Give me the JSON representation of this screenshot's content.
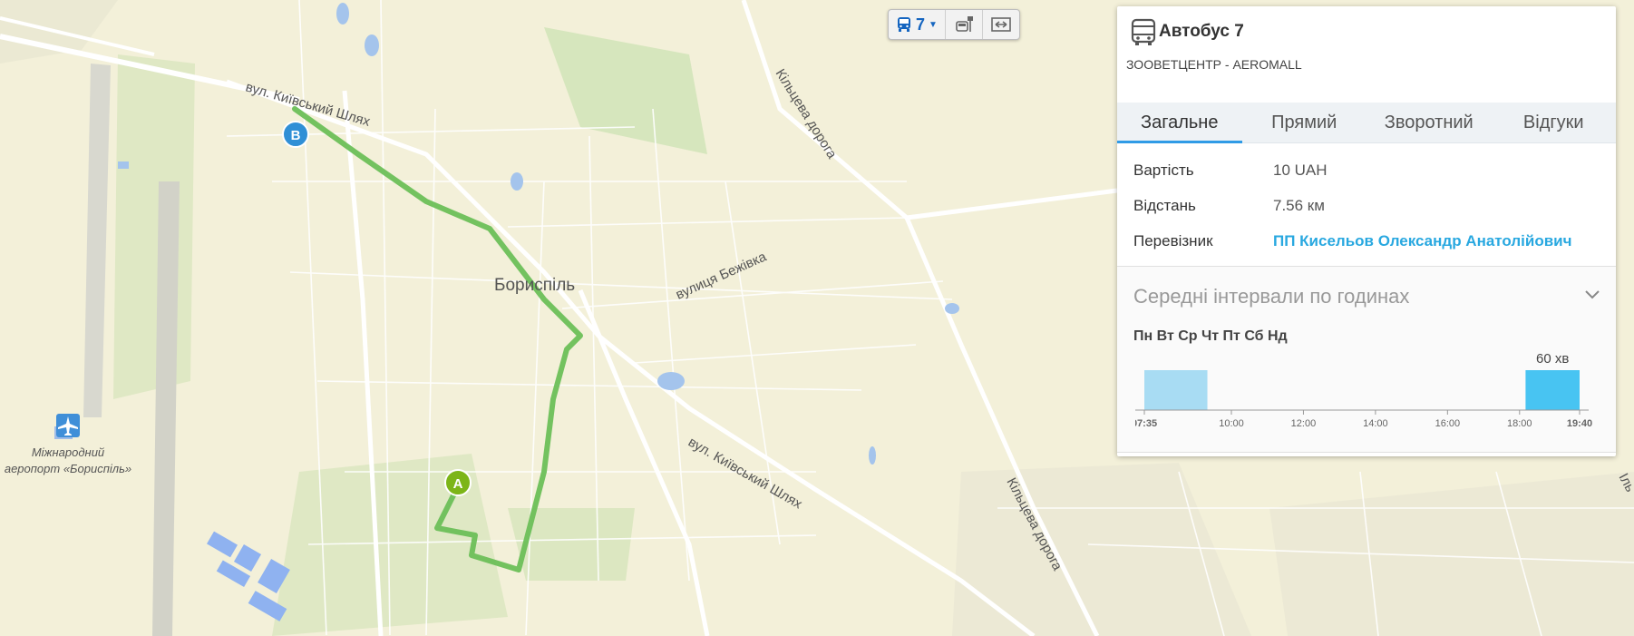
{
  "map": {
    "city_label": "Бориспіль",
    "street_labels": [
      "вул. Київський Шлях",
      "Кільцева дорога",
      "вулиця Бежівка",
      "вул. Київський Шлях",
      "Кільцева дорога",
      "Іль"
    ],
    "airport_label_line1": "Міжнародний",
    "airport_label_line2": "аеропорт «Бориспіль»",
    "marker_a": "A",
    "marker_b": "B",
    "route_color": "#6bbf59",
    "marker_a_color": "#7cb518",
    "marker_b_color": "#2f8fd6"
  },
  "toolbar": {
    "route_number": "7",
    "route_icon": "bus-icon",
    "stops_icon": "bus-stop-icon",
    "fit_icon": "fit-bounds-icon"
  },
  "panel": {
    "title": "Автобус 7",
    "subtitle": "ЗООВЕТЦЕНТР - AEROMALL",
    "tabs": [
      "Загальне",
      "Прямий",
      "Зворотний",
      "Відгуки"
    ],
    "active_tab": 0,
    "info": [
      {
        "key": "Вартість",
        "value": "10 UAH"
      },
      {
        "key": "Відстань",
        "value": "7.56 км"
      },
      {
        "key": "Перевізник",
        "value": "ПП Кисельов Олександр Анатолійович"
      }
    ],
    "accent_color": "#29a8e0",
    "intervals_heading": "Середні інтервали по годинах",
    "days_label": "Пн Вт Ср Чт Пт Сб Нд"
  },
  "chart_data": {
    "type": "bar",
    "x_ticks": [
      "07:35",
      "10:00",
      "12:00",
      "14:00",
      "16:00",
      "18:00",
      "19:40"
    ],
    "bold_ticks": [
      "07:35",
      "19:40"
    ],
    "bars": [
      {
        "from": "07:35",
        "to": "09:20",
        "value": 60,
        "label": "",
        "color": "#a8dcf3"
      },
      {
        "from": "18:10",
        "to": "19:40",
        "value": 60,
        "label": "60 хв",
        "color": "#48c4f2"
      }
    ],
    "x_range": [
      "07:35",
      "19:40"
    ]
  }
}
